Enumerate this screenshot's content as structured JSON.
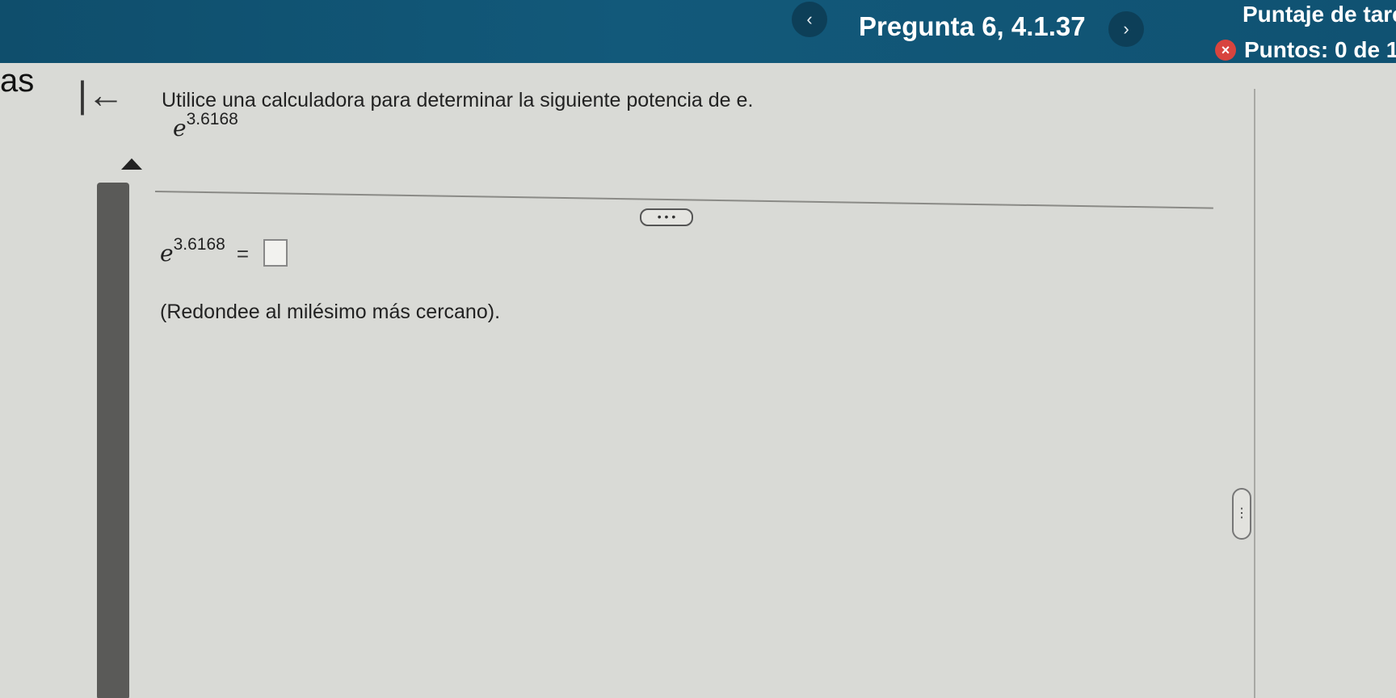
{
  "header": {
    "prev_icon": "‹",
    "question_title": "Pregunta 6, 4.1.37",
    "next_icon": "›",
    "score_label": "Puntaje de tareas:",
    "points_label": "Puntos: 0 de 1"
  },
  "sidebar": {
    "fragment_text": "as",
    "collapse_icon": "|←"
  },
  "question": {
    "prompt": "Utilice una calculadora para determinar la siguiente potencia de  e.",
    "base": "e",
    "exponent": "3.6168",
    "more_button": "• • •",
    "equals": "=",
    "answer_value": "",
    "hint": "(Redondee al milésimo más cercano)."
  },
  "colors": {
    "header_bg": "#12597a",
    "error_icon": "#d8443e"
  }
}
